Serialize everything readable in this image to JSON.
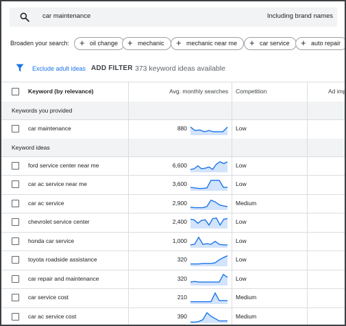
{
  "search": {
    "query": "car maintenance",
    "brand_toggle": "Including brand names"
  },
  "broaden": {
    "label": "Broaden your search:",
    "chips": [
      "oil change",
      "mechanic",
      "mechanic near me",
      "car service",
      "auto repair"
    ]
  },
  "filterbar": {
    "exclude_adult": "Exclude adult ideas",
    "add_filter": "ADD FILTER",
    "count_text": "373 keyword ideas available"
  },
  "table": {
    "columns": {
      "keyword": "Keyword (by relevance)",
      "avg": "Avg. monthly searches",
      "competition": "Competition",
      "ad": "Ad impr"
    },
    "sections": {
      "provided": "Keywords you provided",
      "ideas": "Keyword ideas"
    },
    "provided_rows": [
      {
        "keyword": "car maintenance",
        "searches": "880",
        "competition": "Low",
        "trend": [
          0.7,
          0.4,
          0.45,
          0.3,
          0.4,
          0.3,
          0.3,
          0.3,
          0.7
        ]
      }
    ],
    "idea_rows": [
      {
        "keyword": "ford service center near me",
        "searches": "6,600",
        "competition": "Low",
        "trend": [
          0.25,
          0.3,
          0.55,
          0.3,
          0.35,
          0.45,
          0.25,
          0.7,
          0.9,
          0.75,
          0.9
        ]
      },
      {
        "keyword": "car ac service near me",
        "searches": "3,600",
        "competition": "Low",
        "trend": [
          0.3,
          0.25,
          0.2,
          0.2,
          0.25,
          0.9,
          0.9,
          0.9,
          0.3,
          0.3
        ]
      },
      {
        "keyword": "car ac service",
        "searches": "2,900",
        "competition": "Medium",
        "trend": [
          0.25,
          0.2,
          0.2,
          0.2,
          0.3,
          0.85,
          0.7,
          0.45,
          0.35,
          0.3
        ]
      },
      {
        "keyword": "chevrolet service center",
        "searches": "2,400",
        "competition": "Low",
        "trend": [
          0.8,
          0.75,
          0.45,
          0.7,
          0.75,
          0.3,
          0.85,
          0.9,
          0.3,
          0.8,
          0.85
        ]
      },
      {
        "keyword": "honda car service",
        "searches": "1,000",
        "competition": "Low",
        "trend": [
          0.25,
          0.3,
          0.9,
          0.3,
          0.35,
          0.3,
          0.55,
          0.3,
          0.25,
          0.25
        ]
      },
      {
        "keyword": "toyota roadside assistance",
        "searches": "320",
        "competition": "Low",
        "trend": [
          0.2,
          0.2,
          0.2,
          0.25,
          0.25,
          0.25,
          0.3,
          0.55,
          0.75,
          0.9
        ]
      },
      {
        "keyword": "car repair and maintenance",
        "searches": "320",
        "competition": "Low",
        "trend": [
          0.3,
          0.35,
          0.3,
          0.3,
          0.3,
          0.3,
          0.3,
          0.3,
          0.95,
          0.7
        ]
      },
      {
        "keyword": "car service cost",
        "searches": "210",
        "competition": "Medium",
        "trend": [
          0.2,
          0.2,
          0.2,
          0.2,
          0.2,
          0.2,
          0.95,
          0.3,
          0.3,
          0.3
        ]
      },
      {
        "keyword": "car ac service cost",
        "searches": "390",
        "competition": "Medium",
        "trend": [
          0.1,
          0.1,
          0.15,
          0.3,
          0.9,
          0.6,
          0.4,
          0.2,
          0.2,
          0.2
        ]
      }
    ]
  },
  "colors": {
    "accent": "#1a73e8",
    "spark_line": "#1a73e8",
    "spark_fill": "#d2e3fc",
    "section_bg": "#f1f3f4",
    "divider": "#dadce0"
  },
  "icons": {
    "search": "search-icon",
    "filter": "filter-icon",
    "plus": "plus-icon",
    "sort": "arrow-down-icon"
  }
}
